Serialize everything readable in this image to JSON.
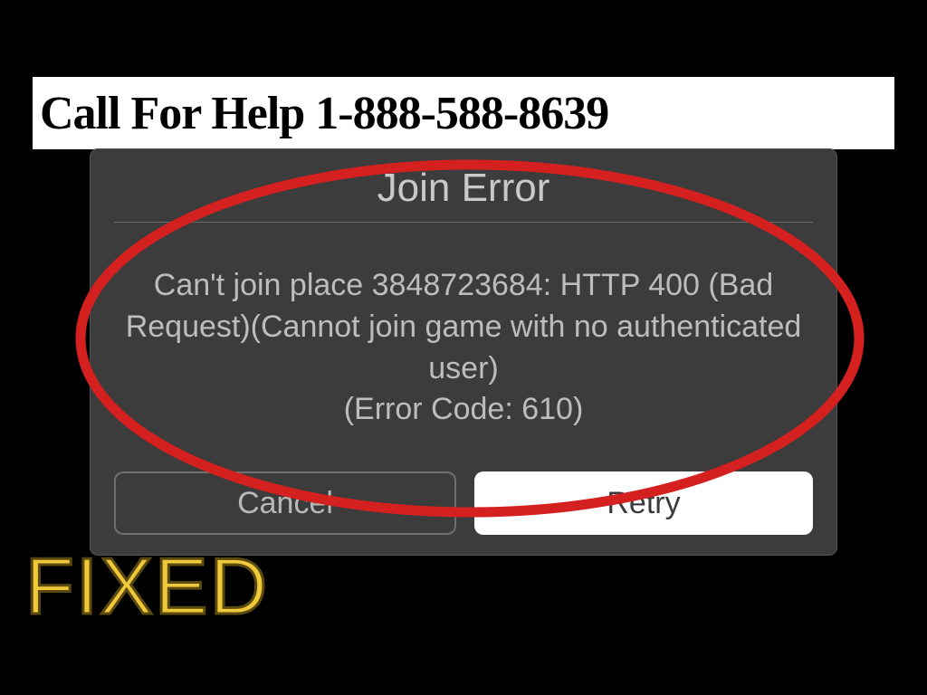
{
  "banner": {
    "text": "Call For Help 1-888-588-8639"
  },
  "dialog": {
    "title": "Join Error",
    "message_line1": "Can't join place 3848723684: HTTP 400 (Bad",
    "message_line2": "Request)(Cannot join game with no authenticated",
    "message_line3": "user)",
    "message_line4": "(Error Code: 610)",
    "cancel_label": "Cancel",
    "retry_label": "Retry"
  },
  "overlay": {
    "fixed_label": "FIXED"
  },
  "annotation": {
    "ellipse_color": "#D4201F"
  }
}
